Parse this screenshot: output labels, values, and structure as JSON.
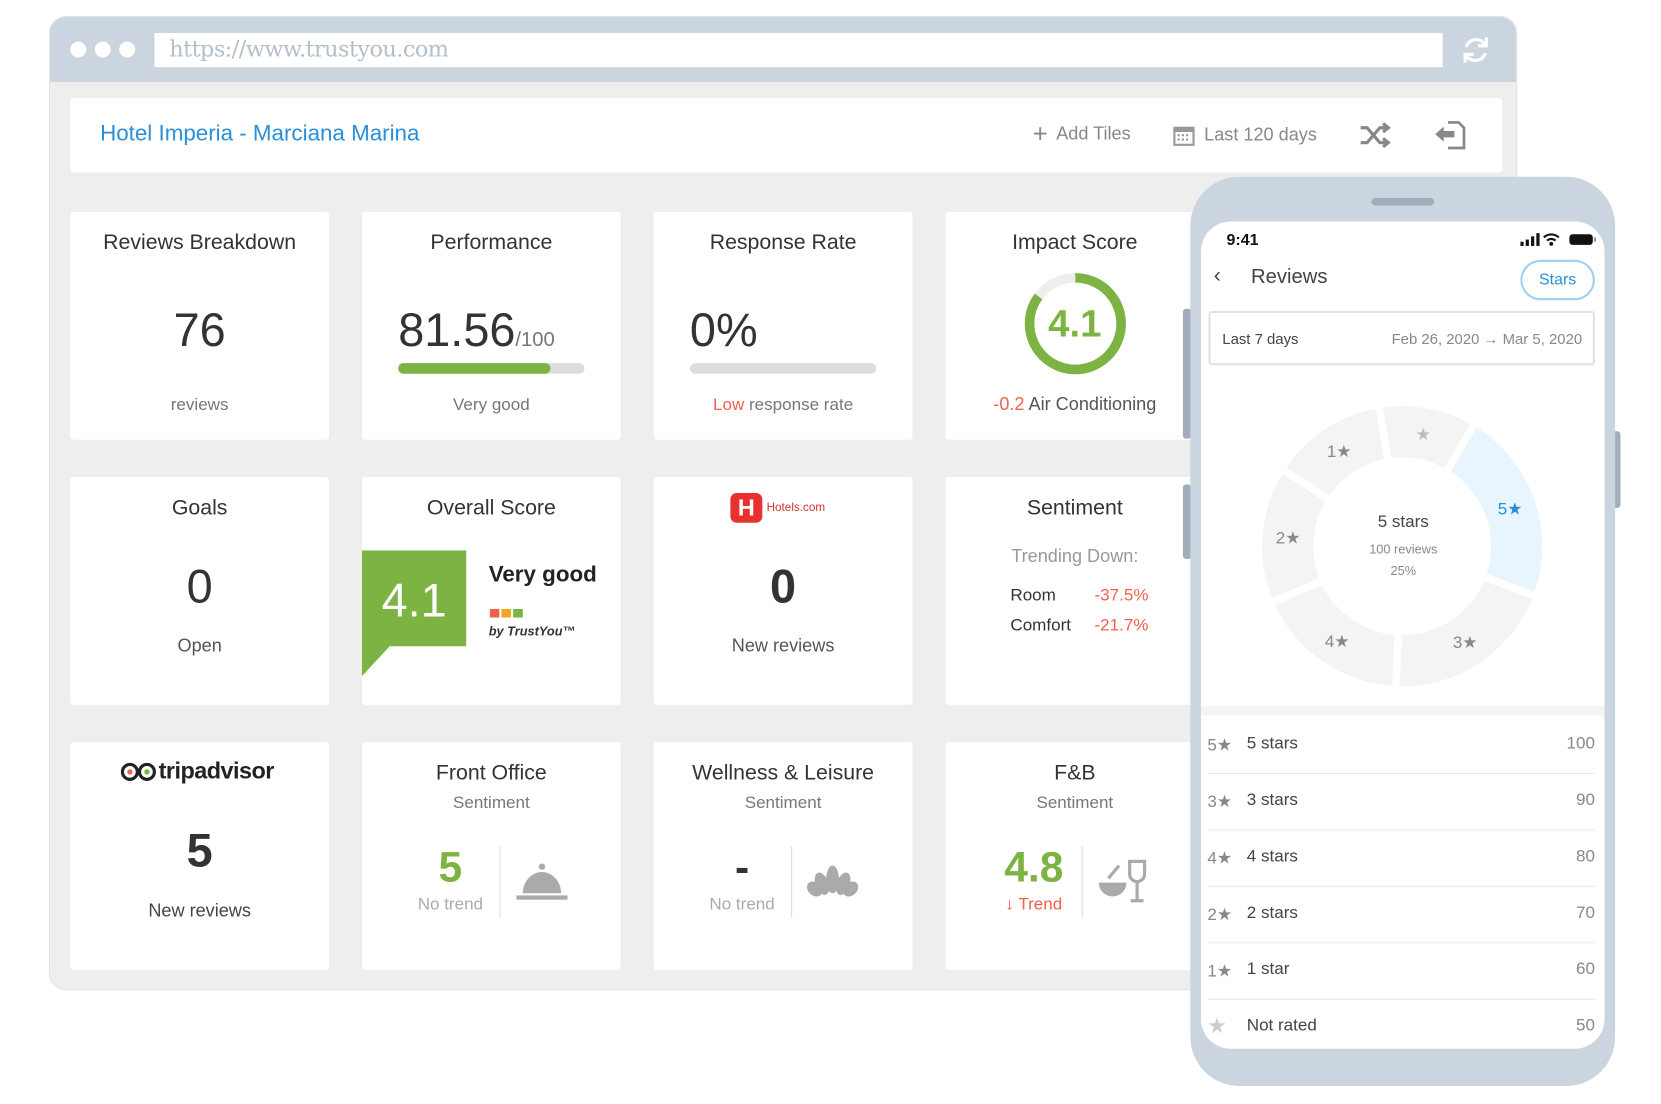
{
  "browser": {
    "url": "https://www.trustyou.com"
  },
  "header": {
    "hotel_name": "Hotel Imperia - Marciana Marina",
    "add_tiles": "Add Tiles",
    "date_range": "Last 120 days"
  },
  "tiles": {
    "reviews_breakdown": {
      "title": "Reviews Breakdown",
      "value": "76",
      "caption": "reviews"
    },
    "performance": {
      "title": "Performance",
      "value": "81.56",
      "max": "/100",
      "caption": "Very good",
      "progress_percent": 81.56,
      "bar_color": "#7cb342"
    },
    "response_rate": {
      "title": "Response Rate",
      "value": "0%",
      "progress_percent": 0,
      "caption_flag": "Low",
      "caption": "response rate"
    },
    "impact_score": {
      "title": "Impact Score",
      "value": "4.1",
      "ring_fraction": 0.85,
      "delta": "-0.2",
      "category": "Air Conditioning"
    },
    "goals": {
      "title": "Goals",
      "value": "0",
      "caption": "Open"
    },
    "overall_score": {
      "title": "Overall Score",
      "value": "4.1",
      "rating": "Very good",
      "brand": "by TrustYou™"
    },
    "hotels_com": {
      "logo": "Hotels.com",
      "value": "0",
      "caption": "New reviews"
    },
    "sentiment": {
      "title": "Sentiment",
      "subtitle": "Trending Down:",
      "items": [
        {
          "label": "Room",
          "value": "-37.5%"
        },
        {
          "label": "Comfort",
          "value": "-21.7%"
        }
      ]
    },
    "tripadvisor": {
      "logo": "tripadvisor",
      "value": "5",
      "caption": "New reviews"
    },
    "front_office": {
      "title": "Front Office",
      "subtitle": "Sentiment",
      "value": "5",
      "trend": "No trend",
      "icon": "bell-icon"
    },
    "wellness": {
      "title": "Wellness & Leisure",
      "subtitle": "Sentiment",
      "value": "-",
      "trend": "No trend",
      "icon": "lotus-icon"
    },
    "fnb": {
      "title": "F&B",
      "subtitle": "Sentiment",
      "value": "4.8",
      "trend_arrow": "↓",
      "trend": "Trend",
      "icon": "food-drink-icon"
    }
  },
  "colors": {
    "accent": "#2a8fd8",
    "green": "#7cb342",
    "red": "#f0624d",
    "highlight": "#e8f5fe"
  },
  "phone": {
    "time": "9:41",
    "title": "Reviews",
    "filter_button": "Stars",
    "period": "Last 7 days",
    "dates": "Feb 26, 2020 → Mar 5, 2020",
    "donut_center": {
      "label": "5 stars",
      "reviews": "100 reviews",
      "percent": "25%"
    },
    "segments": [
      {
        "label": "5★",
        "value": 100,
        "selected": true
      },
      {
        "label": "3★",
        "value": 90
      },
      {
        "label": "4★",
        "value": 80
      },
      {
        "label": "2★",
        "value": 70
      },
      {
        "label": "1★",
        "value": 60
      },
      {
        "label": "★",
        "value": 50
      }
    ],
    "list": [
      {
        "star": "5★",
        "label": "5 stars",
        "count": "100"
      },
      {
        "star": "3★",
        "label": "3 stars",
        "count": "90"
      },
      {
        "star": "4★",
        "label": "4 stars",
        "count": "80"
      },
      {
        "star": "2★",
        "label": "2 stars",
        "count": "70"
      },
      {
        "star": "1★",
        "label": "1 star",
        "count": "60"
      },
      {
        "star": "★",
        "label": "Not rated",
        "count": "50"
      }
    ]
  }
}
